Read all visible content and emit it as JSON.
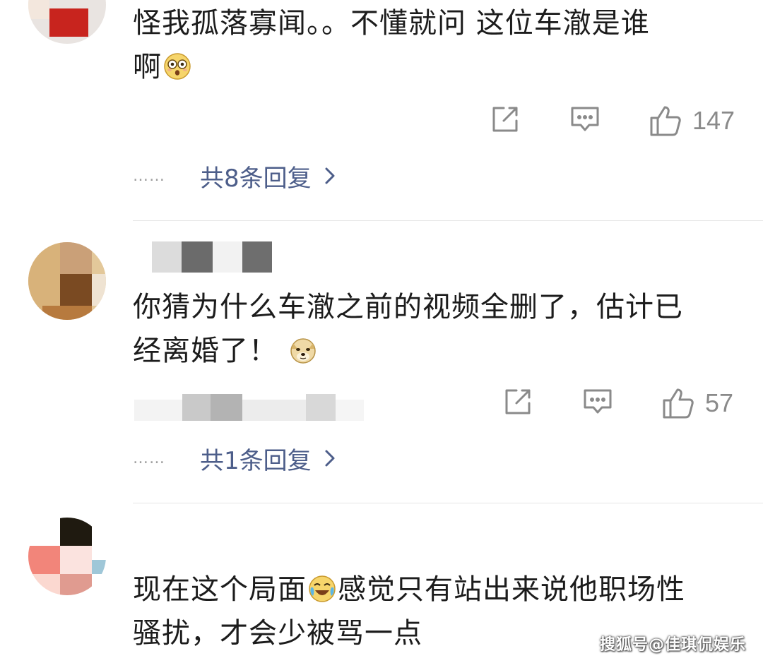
{
  "comments": [
    {
      "text_line1": "怪我孤落寡闻。。不懂就问 这位车澈是谁",
      "text_line2": "啊",
      "emoji": "flushed-face",
      "like_count": "147",
      "reply_label": "共8条回复",
      "dots": "……"
    },
    {
      "text_line1": "你猜为什么车澈之前的视频全删了，估计已",
      "text_line2": "经离婚了！",
      "emoji": "doge-face",
      "like_count": "57",
      "reply_label": "共1条回复",
      "dots": "……"
    },
    {
      "text_before_emoji": "现在这个局面",
      "emoji": "crying-laughing-face",
      "text_after_emoji": "感觉只有站出来说他职场性",
      "text_line2": "骚扰，才会少被骂一点"
    }
  ],
  "watermark": "搜狐号@佳琪侃娱乐",
  "icons": {
    "share": "share-icon",
    "comment": "comment-icon",
    "like": "thumbs-up-icon",
    "chevron": "chevron-right-icon"
  },
  "colors": {
    "link": "#4d5e8a",
    "icon": "#8a8a8a",
    "divider": "#e6e6e6"
  }
}
